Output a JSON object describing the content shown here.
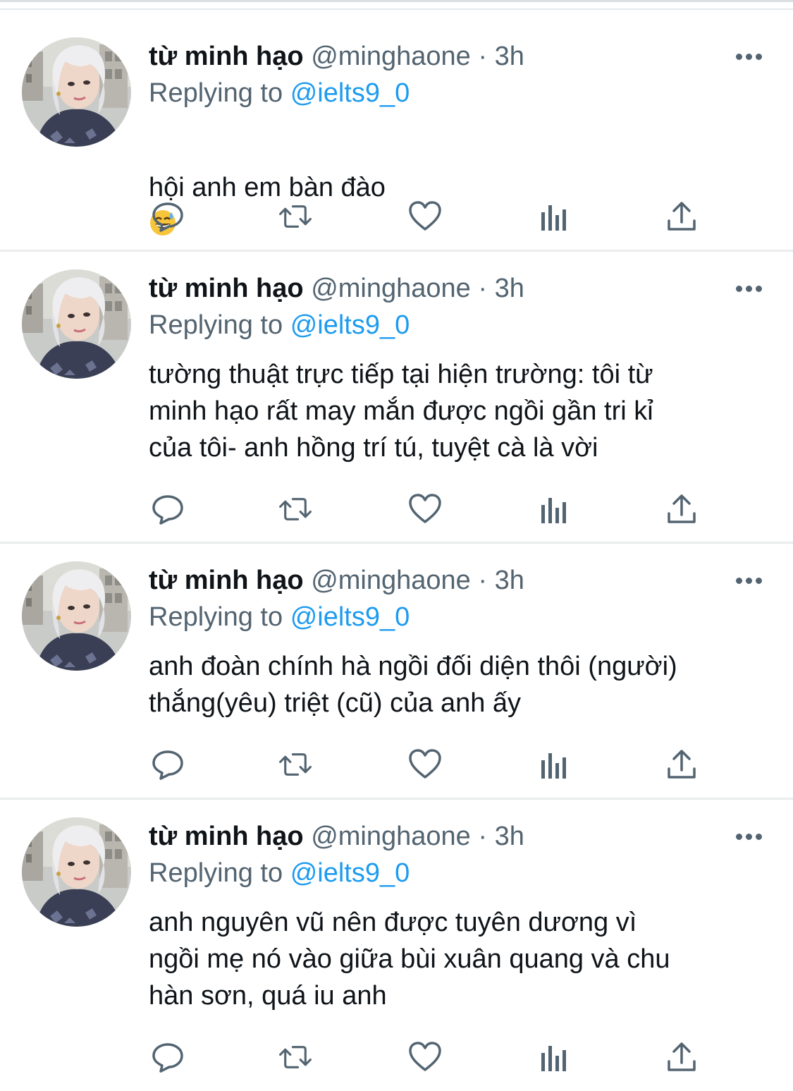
{
  "colors": {
    "text": "#0f1419",
    "secondary": "#536471",
    "accent": "#1d9bf0",
    "divider": "#eaecee"
  },
  "tweets": [
    {
      "name": "từ minh hạo",
      "handle": "@minghaone",
      "dot": "·",
      "time": "3h",
      "replying_prefix": "Replying to",
      "replying_handle": "@ielts9_0",
      "text": "hội anh em bàn đào",
      "emoji": "grinning-face-with-sweat-emoji"
    },
    {
      "name": "từ minh hạo",
      "handle": "@minghaone",
      "dot": "·",
      "time": "3h",
      "replying_prefix": "Replying to",
      "replying_handle": "@ielts9_0",
      "text": "tường thuật trực tiếp tại hiện trường: tôi từ\nminh hạo rất may mắn được ngồi gần tri kỉ\ncủa tôi- anh hồng trí tú, tuyệt cà là vời"
    },
    {
      "name": "từ minh hạo",
      "handle": "@minghaone",
      "dot": "·",
      "time": "3h",
      "replying_prefix": "Replying to",
      "replying_handle": "@ielts9_0",
      "text": "anh đoàn chính hà ngồi đối diện thôi (người)\nthắng(yêu) triệt (cũ) của anh ấy"
    },
    {
      "name": "từ minh hạo",
      "handle": "@minghaone",
      "dot": "·",
      "time": "3h",
      "replying_prefix": "Replying to",
      "replying_handle": "@ielts9_0",
      "text": "anh nguyên vũ nên được tuyên dương vì\nngồi mẹ nó vào giữa bùi xuân quang và chu\nhàn sơn, quá iu anh"
    }
  ],
  "action_icons": [
    "reply-icon",
    "retweet-icon",
    "like-icon",
    "analytics-icon",
    "share-icon"
  ]
}
